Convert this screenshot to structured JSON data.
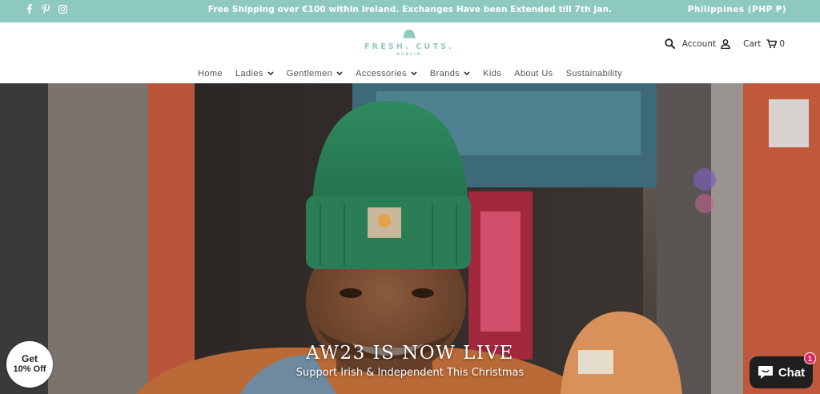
{
  "topbar": {
    "announcement": "Free Shipping over €100 within Ireland. Exchanges Have been Extended till 7th Jan.",
    "currency": "Philippines (PHP ₱)",
    "social_icons": [
      "facebook-icon",
      "pinterest-icon",
      "instagram-icon"
    ]
  },
  "header": {
    "logo_name": "FRESH. CUTS.",
    "logo_sub": "DUBLIN",
    "account_label": "Account",
    "cart_label": "Cart",
    "cart_count": "0"
  },
  "nav": {
    "items": [
      {
        "label": "Home",
        "dropdown": false
      },
      {
        "label": "Ladies",
        "dropdown": true
      },
      {
        "label": "Gentlemen",
        "dropdown": true
      },
      {
        "label": "Accessories",
        "dropdown": true
      },
      {
        "label": "Brands",
        "dropdown": true
      },
      {
        "label": "Kids",
        "dropdown": false
      },
      {
        "label": "About Us",
        "dropdown": false
      },
      {
        "label": "Sustainability",
        "dropdown": false
      }
    ]
  },
  "hero": {
    "title": "AW23 IS NOW LIVE",
    "subtitle": "Support Irish & Independent This Christmas"
  },
  "widgets": {
    "discount_line1": "Get",
    "discount_line2": "10% Off",
    "chat_label": "Chat",
    "chat_badge": "1"
  },
  "colors": {
    "brand_teal": "#8ec9c0",
    "beanie_green": "#2e8a5c",
    "chat_bg": "#1f1f1f",
    "badge": "#e0245e"
  }
}
